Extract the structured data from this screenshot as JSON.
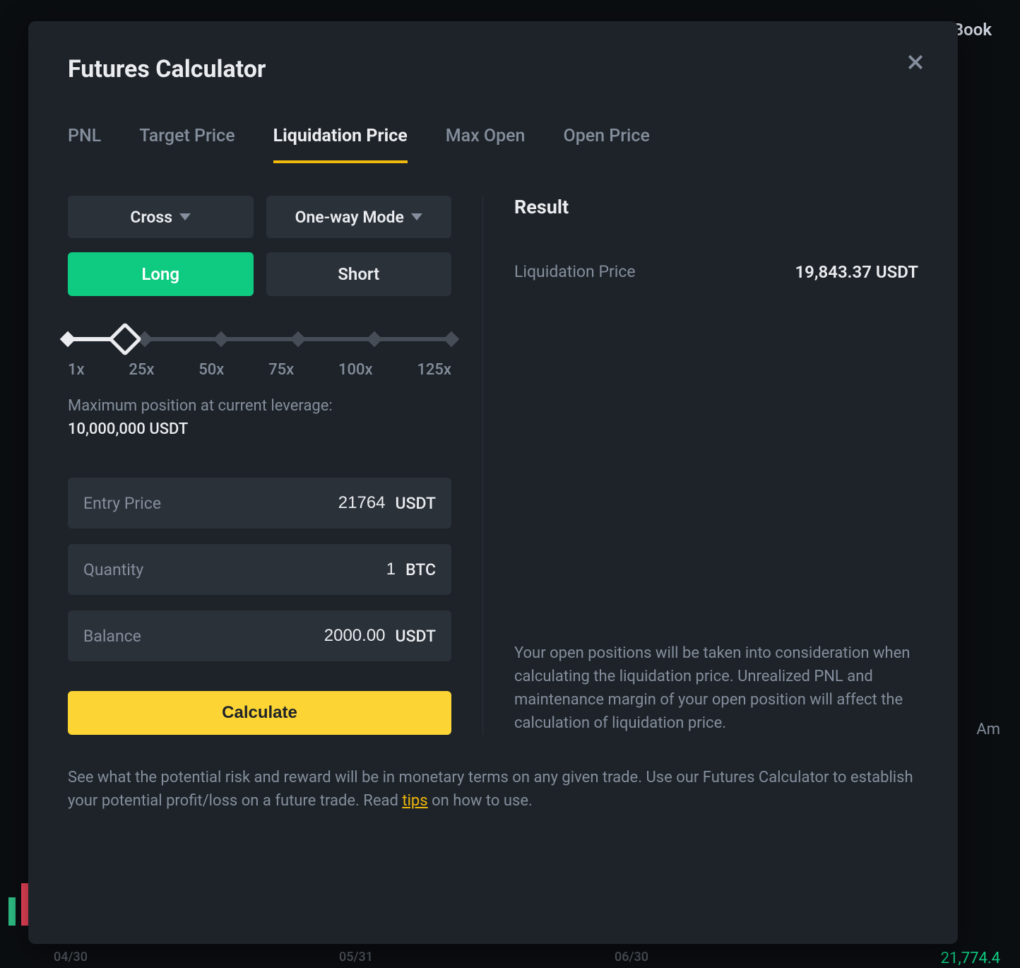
{
  "background": {
    "orderbook": "Order Book",
    "green_num_right": "21,774.4",
    "label_am": "Am",
    "dates": [
      "04/30",
      "05/31",
      "06/30"
    ]
  },
  "modal": {
    "title": "Futures Calculator",
    "tabs": [
      "PNL",
      "Target Price",
      "Liquidation Price",
      "Max Open",
      "Open Price"
    ],
    "active_tab_index": 2,
    "margin_mode": "Cross",
    "position_mode": "One-way Mode",
    "side_long": "Long",
    "side_short": "Short",
    "leverage": {
      "labels": [
        "1x",
        "25x",
        "50x",
        "75x",
        "100x",
        "125x"
      ],
      "current_fraction": 0.15
    },
    "maxpos_label": "Maximum position at current leverage:",
    "maxpos_value": "10,000,000 USDT",
    "inputs": {
      "entry_price": {
        "label": "Entry Price",
        "value": "21764",
        "unit": "USDT"
      },
      "quantity": {
        "label": "Quantity",
        "value": "1",
        "unit": "BTC"
      },
      "balance": {
        "label": "Balance",
        "value": "2000.00",
        "unit": "USDT"
      }
    },
    "calculate": "Calculate",
    "result": {
      "title": "Result",
      "label": "Liquidation Price",
      "value": "19,843.37 USDT",
      "note": "Your open positions will be taken into consideration when calculating the liquidation price. Unrealized PNL and maintenance margin of your open position will affect the calculation of liquidation price."
    },
    "footer": {
      "text_before": "See what the potential risk and reward will be in monetary terms on any given trade. Use our Futures Calculator to establish your potential profit/loss on a future trade. Read ",
      "link": "tips",
      "text_after": " on how to use."
    }
  }
}
